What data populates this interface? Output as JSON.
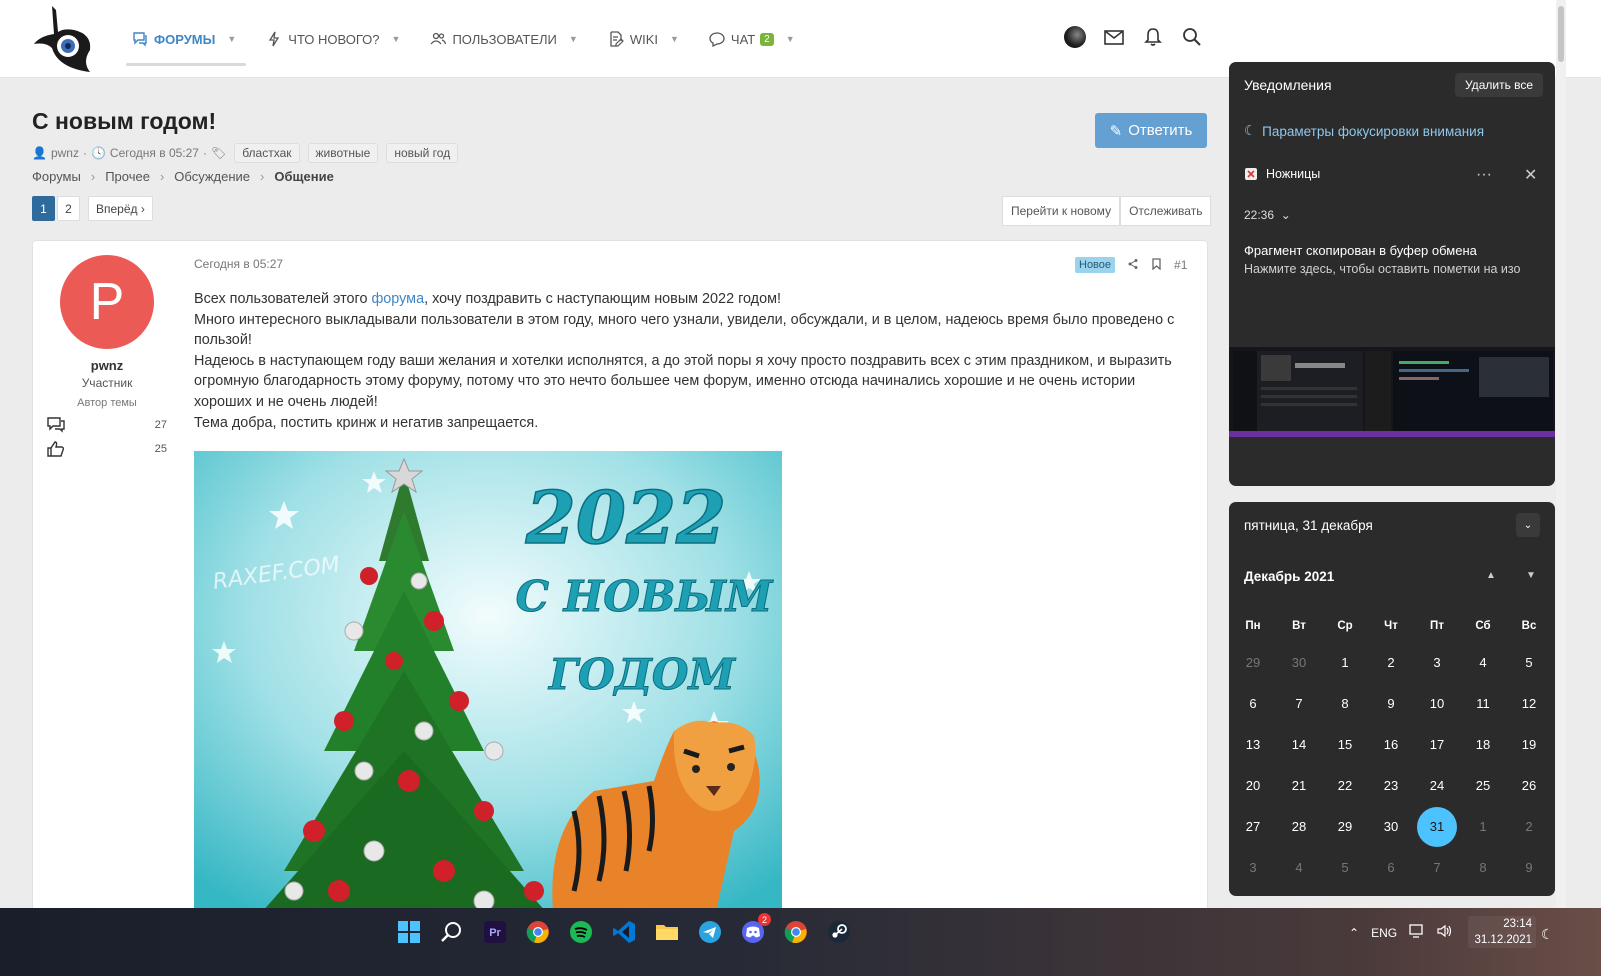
{
  "nav": {
    "items": [
      {
        "label": "Форумы",
        "icon": "forums-icon",
        "active": true
      },
      {
        "label": "Что нового?",
        "icon": "bolt-icon"
      },
      {
        "label": "Пользователи",
        "icon": "users-icon"
      },
      {
        "label": "Wiki",
        "icon": "wiki-icon"
      },
      {
        "label": "Чат",
        "icon": "chat-icon",
        "badge": "2"
      }
    ]
  },
  "thread": {
    "title": "С новым годом!",
    "author": "pwnz",
    "date": "Сегодня в 05:27",
    "tags": [
      "бластхак",
      "животные",
      "новый год"
    ],
    "reply_label": "Ответить"
  },
  "breadcrumb": [
    "Форумы",
    "Прочее",
    "Обсуждение",
    "Общение"
  ],
  "pager": {
    "pages": [
      "1",
      "2"
    ],
    "next_label": "Вперёд"
  },
  "actions": {
    "goto_new": "Перейти к новому",
    "watch": "Отслеживать"
  },
  "post": {
    "avatar_letter": "P",
    "user": "pwnz",
    "role": "Участник",
    "author_label": "Автор темы",
    "messages": "27",
    "likes": "25",
    "date": "Сегодня в 05:27",
    "new_label": "Новое",
    "number": "#1",
    "line1_a": "Всех пользователей этого ",
    "line1_link": "форума",
    "line1_b": ", хочу поздравить с наступающим новым 2022 годом!",
    "line2": "Много интересного выкладывали пользователи в этом году, много чего узнали, увидели, обсуждали, и в целом, надеюсь время было проведено с пользой!",
    "line3": "Надеюсь в наступающем году ваши желания и хотелки исполнятся, а до этой поры я хочу просто поздравить всех с этим праздником, и выразить огромную благодарность этому форуму, потому что это нечто большее чем форум, именно отсюда начинались хорошие и не очень истории хороших и не очень людей!",
    "line4": "Тема добра, постить кринж и негатив запрещается.",
    "image": {
      "year": "2022",
      "line1": "С НОВЫМ",
      "line2": "ГОДОМ",
      "watermark": "RAXEF.COM"
    }
  },
  "notifications": {
    "title": "Уведомления",
    "clear_all": "Удалить все",
    "focus": "Параметры фокусировки внимания",
    "app": "Ножницы",
    "time": "22:36",
    "msg_title": "Фрагмент скопирован в буфер обмена",
    "msg_body": "Нажмите здесь, чтобы оставить пометки на изо"
  },
  "calendar": {
    "date_header": "пятница, 31 декабря",
    "month": "Декабрь 2021",
    "weekdays": [
      "Пн",
      "Вт",
      "Ср",
      "Чт",
      "Пт",
      "Сб",
      "Вс"
    ],
    "days": [
      "29",
      "30",
      "1",
      "2",
      "3",
      "4",
      "5",
      "6",
      "7",
      "8",
      "9",
      "10",
      "11",
      "12",
      "13",
      "14",
      "15",
      "16",
      "17",
      "18",
      "19",
      "20",
      "21",
      "22",
      "23",
      "24",
      "25",
      "26",
      "27",
      "28",
      "29",
      "30",
      "31",
      "1",
      "2",
      "3",
      "4",
      "5",
      "6",
      "7",
      "8",
      "9"
    ],
    "muted": [
      0,
      1,
      33,
      34,
      35,
      36,
      37,
      38,
      39,
      40,
      41
    ],
    "today": 32
  },
  "taskbar": {
    "apps": [
      "windows-start",
      "search",
      "premiere",
      "chrome",
      "spotify",
      "vscode",
      "explorer",
      "telegram",
      "discord",
      "chrome",
      "steam"
    ],
    "discord_badge": "2",
    "lang": "ENG",
    "time": "23:14",
    "date": "31.12.2021"
  }
}
